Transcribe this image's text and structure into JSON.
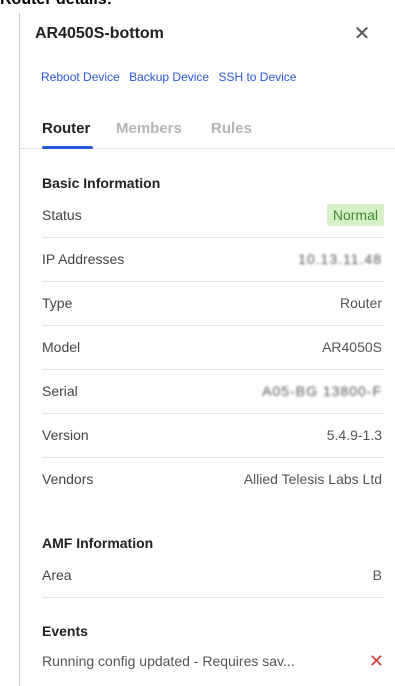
{
  "page": {
    "heading": "Router details:"
  },
  "panel": {
    "device_name": "AR4050S-bottom",
    "close_icon": "close-icon",
    "actions": [
      "Reboot Device",
      "Backup Device",
      "SSH to Device"
    ],
    "tabs": [
      {
        "label": "Router",
        "active": true
      },
      {
        "label": "Members",
        "active": false
      },
      {
        "label": "Rules",
        "active": false
      }
    ]
  },
  "basic_info": {
    "title": "Basic Information",
    "rows": [
      {
        "label": "Status",
        "value": "Normal"
      },
      {
        "label": "IP Addresses",
        "value": "10.13.11.48"
      },
      {
        "label": "Type",
        "value": "Router"
      },
      {
        "label": "Model",
        "value": "AR4050S"
      },
      {
        "label": "Serial",
        "value": "A05-BG 13800-F"
      },
      {
        "label": "Version",
        "value": "5.4.9-1.3"
      },
      {
        "label": "Vendors",
        "value": "Allied Telesis Labs Ltd"
      }
    ]
  },
  "amf_info": {
    "title": "AMF Information",
    "rows": [
      {
        "label": "Area",
        "value": "B"
      }
    ]
  },
  "events": {
    "title": "Events",
    "items": [
      {
        "text": "Running config updated - Requires sav...",
        "dismiss_icon": "close-icon",
        "dismiss_color": "#d33c3c"
      }
    ]
  },
  "colors": {
    "link": "#2a5ad8",
    "status_bg": "#d8f0c8",
    "status_text": "#3f8c2a"
  }
}
